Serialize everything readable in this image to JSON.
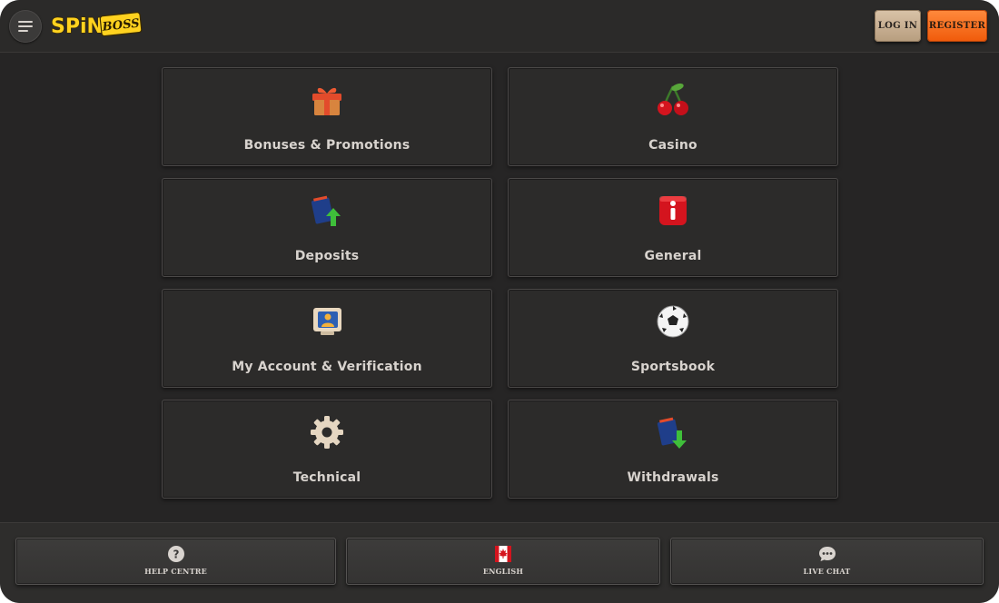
{
  "header": {
    "menu_icon": "hamburger-icon",
    "logo_text_a": "SPiN",
    "logo_text_b": "BOSS",
    "login_label": "LOG IN",
    "register_label": "REGISTER"
  },
  "categories": [
    {
      "label": "Bonuses & Promotions",
      "icon": "gift-icon"
    },
    {
      "label": "Casino",
      "icon": "cherries-icon"
    },
    {
      "label": "Deposits",
      "icon": "wallet-up-icon"
    },
    {
      "label": "General",
      "icon": "info-icon"
    },
    {
      "label": "My Account & Verification",
      "icon": "account-monitor-icon"
    },
    {
      "label": "Sportsbook",
      "icon": "soccer-ball-icon"
    },
    {
      "label": "Technical",
      "icon": "gear-icon"
    },
    {
      "label": "Withdrawals",
      "icon": "wallet-down-icon"
    }
  ],
  "footer": {
    "help_label": "HELP CENTRE",
    "help_icon": "question-circle-icon",
    "language_label": "ENGLISH",
    "language_icon": "canada-flag-icon",
    "chat_label": "LIVE CHAT",
    "chat_icon": "chat-bubble-icon"
  },
  "colors": {
    "background": "#262525",
    "register": "#f05a0a",
    "login": "#c9b192",
    "logo_yellow": "#ffd21f"
  }
}
